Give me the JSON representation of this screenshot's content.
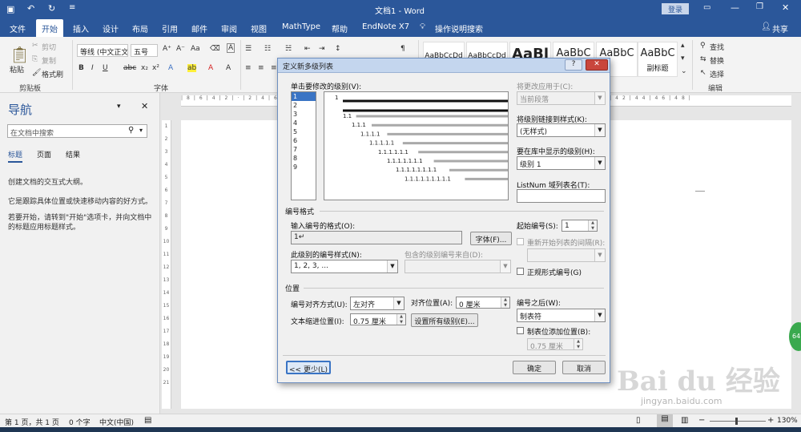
{
  "window": {
    "title": "文档1 - Word",
    "login": "登录"
  },
  "menu": {
    "items": [
      "文件",
      "开始",
      "插入",
      "设计",
      "布局",
      "引用",
      "邮件",
      "审阅",
      "视图",
      "MathType",
      "帮助",
      "EndNote X7",
      "操作说明搜索"
    ],
    "share": "共享"
  },
  "ribbon": {
    "clipboard": {
      "paste": "粘贴",
      "cut": "剪切",
      "copy": "复制",
      "format_painter": "格式刷",
      "group": "剪贴板"
    },
    "font": {
      "name": "等线 (中文正文)",
      "size": "五号",
      "group": "字体"
    },
    "styles": [
      "AaBbCcDd",
      "AaBbCcDd",
      "AaBl",
      "AaBbC",
      "AaBbC",
      "AaBbC"
    ],
    "style_captions": {
      "s6": "副标题"
    },
    "edit": {
      "find": "查找",
      "replace": "替换",
      "select": "选择",
      "group": "编辑"
    }
  },
  "nav": {
    "title": "导航",
    "search_placeholder": "在文档中搜索",
    "tabs": [
      "标题",
      "页面",
      "结果"
    ],
    "line1": "创建文档的交互式大纲。",
    "line2": "它是跟踪具体位置或快速移动内容的好方式。",
    "line3": "若要开始，请转到\"开始\"选项卡，并向文档中的标题应用标题样式。"
  },
  "status": {
    "page": "第 1 页，共 1 页",
    "words": "0 个字",
    "lang": "中文(中国)",
    "zoom": "130%"
  },
  "dialog": {
    "title": "定义新多级列表",
    "help": "?",
    "close": "✕",
    "level_label": "单击要修改的级别(V):",
    "levels": [
      "1",
      "2",
      "3",
      "4",
      "5",
      "6",
      "7",
      "8",
      "9"
    ],
    "preview_rows": [
      "1",
      "1.1",
      "1.1.1",
      "1.1.1.1",
      "1.1.1.1.1",
      "1.1.1.1.1.1",
      "1.1.1.1.1.1.1",
      "1.1.1.1.1.1.1.1",
      "1.1.1.1.1.1.1.1.1"
    ],
    "apply_label": "将更改应用于(C):",
    "apply_value": "当前段落",
    "link_label": "将级别链接到样式(K):",
    "link_value": "(无样式)",
    "gallery_label": "要在库中显示的级别(H):",
    "gallery_value": "级别 1",
    "listnum_label": "ListNum 域列表名(T):",
    "listnum_value": "",
    "numfmt_section": "编号格式",
    "enter_fmt_label": "输入编号的格式(O):",
    "enter_fmt_value": "1↵",
    "font_btn": "字体(F)...",
    "style_label": "此级别的编号样式(N):",
    "style_value": "1, 2, 3, ...",
    "include_label": "包含的级别编号来自(D):",
    "include_value": "",
    "start_label": "起始编号(S):",
    "start_value": "1",
    "restart_label": "重新开始列表的间隔(R):",
    "restart_value": "",
    "legal_label": "正规形式编号(G)",
    "position_section": "位置",
    "align_label": "编号对齐方式(U):",
    "align_value": "左对齐",
    "alignat_label": "对齐位置(A):",
    "alignat_value": "0 厘米",
    "indent_label": "文本缩进位置(I):",
    "indent_value": "0.75 厘米",
    "setall_btn": "设置所有级别(E)...",
    "follow_label": "编号之后(W):",
    "follow_value": "制表符",
    "tabadd_label": "制表位添加位置(B):",
    "tabadd_value": "0.75 厘米",
    "less_btn": "<< 更少(L)",
    "ok_btn": "确定",
    "cancel_btn": "取消"
  },
  "overlay": {
    "badge": "64",
    "watermark": "Bai du 经验",
    "watermark_url": "jingyan.baidu.com"
  }
}
